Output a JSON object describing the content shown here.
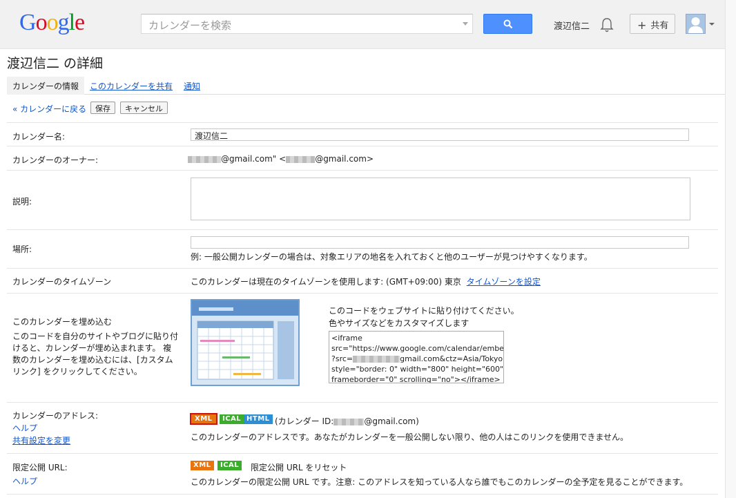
{
  "header": {
    "logo_letters": [
      "G",
      "o",
      "o",
      "g",
      "l",
      "e"
    ],
    "search_placeholder": "カレンダーを検索",
    "user_name": "渡辺信二",
    "share_label": "共有",
    "share_plus": "+"
  },
  "page": {
    "title": "渡辺信二 の詳細",
    "tabs": [
      {
        "label": "カレンダーの情報",
        "active": true
      },
      {
        "label": "このカレンダーを共有",
        "active": false
      },
      {
        "label": "通知",
        "active": false
      }
    ],
    "back_link": "« カレンダーに戻る",
    "save_label": "保存",
    "cancel_label": "キャンセル"
  },
  "form": {
    "name_label": "カレンダー名:",
    "name_value": "渡辺信二",
    "owner_label": "カレンダーのオーナー:",
    "owner_part1": "@gmail.com\"",
    "owner_part2": "<",
    "owner_part3": "@gmail.com>",
    "description_label": "説明:",
    "location_label": "場所:",
    "location_note": "例: 一般公開カレンダーの場合は、対象エリアの地名を入れておくと他のユーザーが見つけやすくなります。",
    "timezone_label": "カレンダーのタイムゾーン",
    "timezone_text": "このカレンダーは現在のタイムゾーンを使用します: (GMT+09:00) 東京",
    "timezone_link": "タイムゾーンを設定",
    "embed_title": "このカレンダーを埋め込む",
    "embed_desc": [
      "このコードを自分のサイトやブログに貼り付",
      "けると、カレンダーが埋め込まれます。 複",
      "数のカレンダーを埋め込むには、[カスタム",
      "リンク] をクリックしてください。"
    ],
    "embed_instruction": "このコードをウェブサイトに貼り付けてください。",
    "embed_customize_link": "色やサイズなどをカスタマイズします",
    "embed_code_lines": [
      "<iframe",
      "src=\"https://www.google.com/calendar/embed",
      "?src=",
      "gmail.com&ctz=Asia/Tokyo\"",
      "style=\"border: 0\" width=\"800\" height=\"600\"",
      "frameborder=\"0\" scrolling=\"no\"></iframe>"
    ],
    "address_label": "カレンダーのアドレス:",
    "help_label": "ヘルプ",
    "sharing_link": "共有設定を変更",
    "badge_xml": "XML",
    "badge_ical": "ICAL",
    "badge_html": "HTML",
    "calendar_id_prefix": "(カレンダー ID:",
    "calendar_id_suffix": "@gmail.com)",
    "address_note": "このカレンダーのアドレスです。あなたがカレンダーを一般公開しない限り、他の人はこのリンクを使用できません。",
    "private_label": "限定公開 URL:",
    "private_help": "ヘルプ",
    "reset_link": "限定公開 URL をリセット",
    "private_note": "このカレンダーの限定公開 URL です。注意: このアドレスを知っている人なら誰でもこのカレンダーの全予定を見ることができます。"
  },
  "colors": {
    "badge_xml": "#e8740f",
    "badge_ical": "#3aae2a",
    "badge_html": "#2b8fd6",
    "link": "#1155cc",
    "search_button": "#4d90fe"
  }
}
